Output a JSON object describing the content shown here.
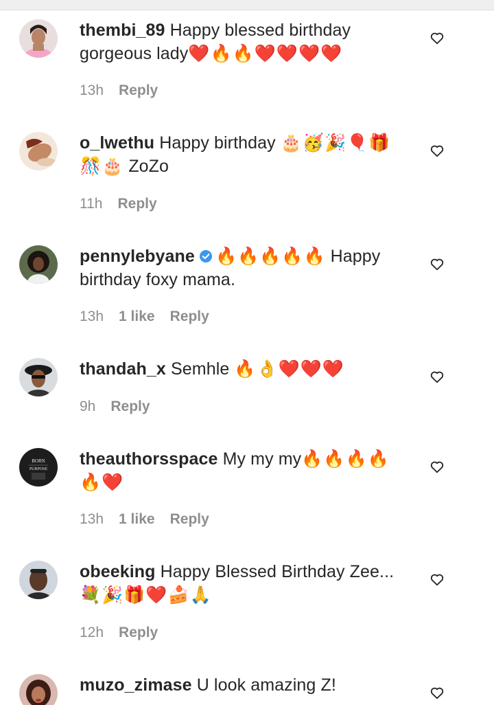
{
  "colors": {
    "text": "#262626",
    "muted": "#8e8e8e",
    "verified": "#3897f0"
  },
  "comments": [
    {
      "username": "thembi_89",
      "text": "Happy blessed birthday gorgeous lady",
      "emojis": "❤️🔥🔥❤️❤️❤️❤️",
      "time": "13h",
      "likes": "",
      "reply": "Reply",
      "verified": false,
      "avatar_icon": "avatar-woman-pink"
    },
    {
      "username": "o_lwethu",
      "text": "Happy birthday",
      "emojis": "🎂🥳🎉🎈🎁🎊🎂",
      "text_after": "ZoZo",
      "time": "11h",
      "likes": "",
      "reply": "Reply",
      "verified": false,
      "avatar_icon": "avatar-woman-lying"
    },
    {
      "username": "pennylebyane",
      "emojis": "🔥🔥🔥🔥🔥",
      "text": "Happy birthday foxy mama.",
      "time": "13h",
      "likes": "1 like",
      "reply": "Reply",
      "verified": true,
      "avatar_icon": "avatar-woman-dark"
    },
    {
      "username": "thandah_x",
      "text": "Semhle",
      "emojis": "🔥👌❤️❤️❤️",
      "time": "9h",
      "likes": "",
      "reply": "Reply",
      "verified": false,
      "avatar_icon": "avatar-woman-hat"
    },
    {
      "username": "theauthorsspace",
      "text": "My my my",
      "emojis": "🔥🔥🔥🔥🔥❤️",
      "time": "13h",
      "likes": "1 like",
      "reply": "Reply",
      "verified": false,
      "avatar_icon": "avatar-born-purpose",
      "avatar_text_1": "BORN",
      "avatar_text_2": "PURPOSE"
    },
    {
      "username": "obeeking",
      "text": "Happy Blessed Birthday Zee...",
      "emojis": "💐🎉🎁❤️🍰🙏",
      "time": "12h",
      "likes": "",
      "reply": "Reply",
      "verified": false,
      "avatar_icon": "avatar-man"
    },
    {
      "username": "muzo_zimase",
      "text": "U look amazing Z!",
      "emojis": "",
      "time": "",
      "likes": "",
      "reply": "",
      "verified": false,
      "avatar_icon": "avatar-woman-red"
    }
  ]
}
